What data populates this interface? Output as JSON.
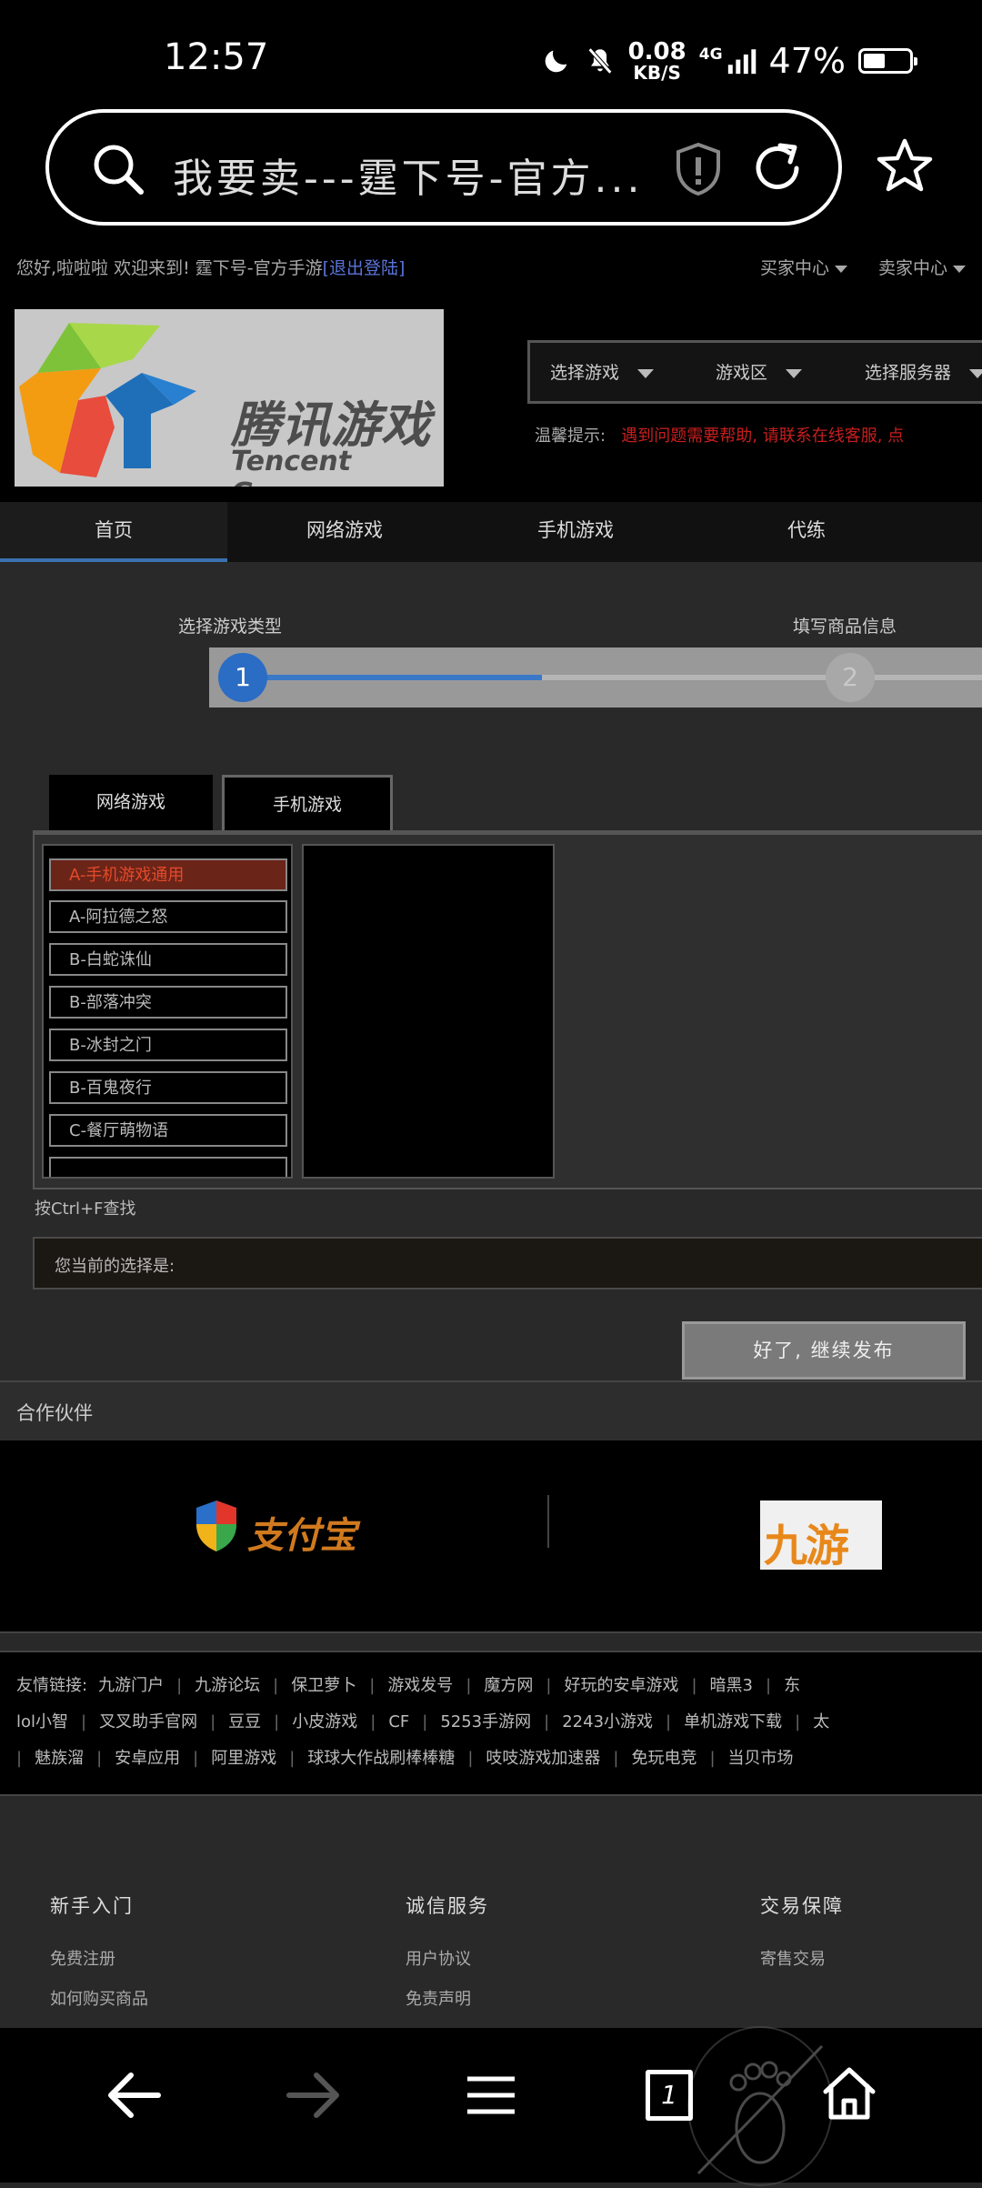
{
  "status_bar": {
    "time": "12:57",
    "net_speed": "0.08",
    "net_speed_unit": "KB/S",
    "network": "4G",
    "battery_percent": "47%",
    "battery_level": 0.47
  },
  "url_bar": {
    "text": "我要卖---霆下号-官方..."
  },
  "top_bar": {
    "greeting": "您好,啦啦啦 欢迎来到!  霆下号-官方手游",
    "logout_label": "[退出登陆]",
    "buyer_center": "买家中心",
    "seller_center": "卖家中心"
  },
  "logo": {
    "brand_cn": "腾讯游戏",
    "brand_en": "Tencent Games"
  },
  "selectors": {
    "game": "选择游戏",
    "area": "游戏区",
    "server": "选择服务器"
  },
  "tip": {
    "label": "温馨提示:",
    "text": "遇到问题需要帮助, 请联系在线客服, 点"
  },
  "main_nav": [
    "首页",
    "网络游戏",
    "手机游戏",
    "代练"
  ],
  "steps": {
    "step1_label": "选择游戏类型",
    "step2_label": "填写商品信息",
    "step1_number": "1",
    "step2_number": "2",
    "progress": 0.4
  },
  "game_tabs": {
    "online": "网络游戏",
    "mobile": "手机游戏"
  },
  "game_list": [
    "A-手机游戏通用",
    "A-阿拉德之怒",
    "B-白蛇诛仙",
    "B-部落冲突",
    "B-冰封之门",
    "B-百鬼夜行",
    "C-餐厅萌物语"
  ],
  "hint": "按Ctrl+F查找",
  "current_selection_label": "您当前的选择是:",
  "continue_button": "好了, 继续发布",
  "partners": {
    "title": "合作伙伴",
    "alipay": "支付宝",
    "jiuyou": "九游"
  },
  "links": {
    "label": "友情链接:",
    "row1": [
      "九游门户",
      "九游论坛",
      "保卫萝卜",
      "游戏发号",
      "魔方网",
      "好玩的安卓游戏",
      "暗黑3",
      "东"
    ],
    "row2": [
      "lol小智",
      "叉叉助手官网",
      "豆豆",
      "小皮游戏",
      "CF",
      "5253手游网",
      "2243小游戏",
      "单机游戏下载",
      "太"
    ],
    "row3": [
      "魅族溜",
      "安卓应用",
      "阿里游戏",
      "球球大作战刷棒棒糖",
      "吱吱游戏加速器",
      "免玩电竞",
      "当贝市场"
    ]
  },
  "footer": {
    "col1": {
      "title": "新手入门",
      "items": [
        "免费注册",
        "如何购买商品"
      ]
    },
    "col2": {
      "title": "诚信服务",
      "items": [
        "用户协议",
        "免责声明"
      ]
    },
    "col3": {
      "title": "交易保障",
      "items": [
        "寄售交易"
      ]
    }
  },
  "bottom_nav": {
    "tab_count": "1"
  }
}
